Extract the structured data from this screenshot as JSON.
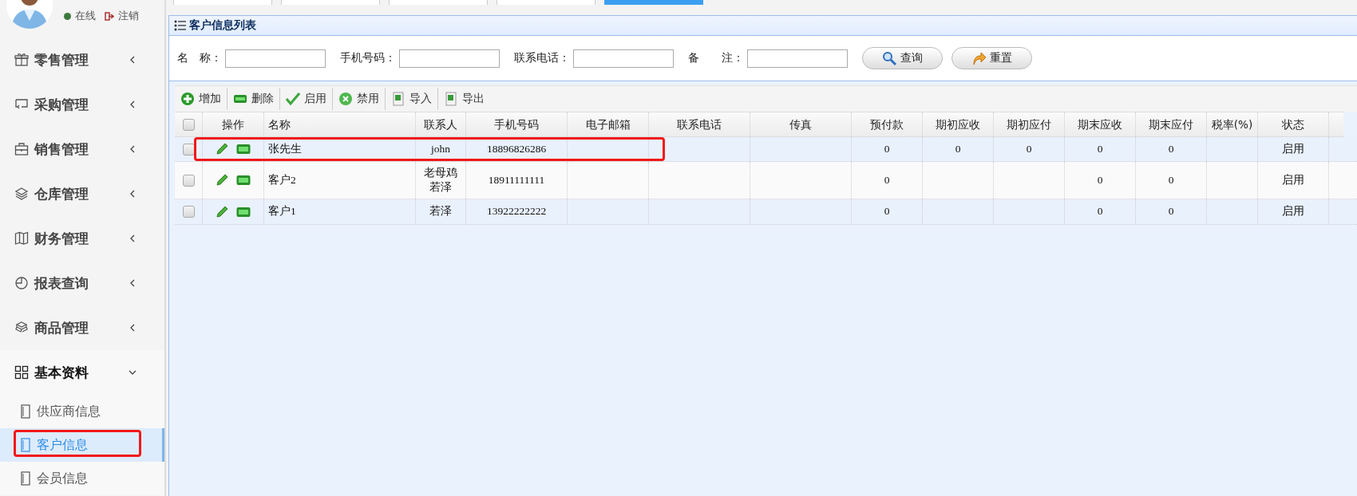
{
  "user": {
    "status": "在线",
    "logout": "注销"
  },
  "tabs": [
    {
      "selected": false
    },
    {
      "selected": false
    },
    {
      "selected": false
    },
    {
      "selected": false
    },
    {
      "selected": true
    }
  ],
  "sidebar": {
    "items": [
      {
        "label": "零售管理",
        "expanded": false
      },
      {
        "label": "采购管理",
        "expanded": false
      },
      {
        "label": "销售管理",
        "expanded": false
      },
      {
        "label": "仓库管理",
        "expanded": false
      },
      {
        "label": "财务管理",
        "expanded": false
      },
      {
        "label": "报表查询",
        "expanded": false
      },
      {
        "label": "商品管理",
        "expanded": false
      },
      {
        "label": "基本资料",
        "expanded": true,
        "children": [
          {
            "label": "供应商信息",
            "selected": false,
            "highlighted": false
          },
          {
            "label": "客户信息",
            "selected": true,
            "highlighted": true
          },
          {
            "label": "会员信息",
            "selected": false,
            "highlighted": false
          }
        ]
      }
    ]
  },
  "panel": {
    "title": "客户信息列表"
  },
  "search": {
    "fields": [
      {
        "label": "名　称："
      },
      {
        "label": "手机号码："
      },
      {
        "label": "联系电话："
      },
      {
        "label": "备　　注："
      }
    ],
    "buttons": [
      "查询",
      "重置"
    ]
  },
  "toolbar": [
    "增加",
    "删除",
    "启用",
    "禁用",
    "导入",
    "导出"
  ],
  "table": {
    "header_checked": false,
    "columns": [
      "操作",
      "名称",
      "联系人",
      "手机号码",
      "电子邮箱",
      "联系电话",
      "传真",
      "预付款",
      "期初应收",
      "期初应付",
      "期末应收",
      "期末应付",
      "税率(%)",
      "状态"
    ],
    "rows": [
      {
        "checked": false,
        "highlighted": true,
        "cells": [
          null,
          "张先生",
          "john",
          "18896826286",
          null,
          null,
          null,
          "0",
          "0",
          "0",
          "0",
          "0",
          null,
          "启用"
        ]
      },
      {
        "checked": false,
        "highlighted": false,
        "cells": [
          null,
          "客户2",
          "老母鸡若泽",
          "18911111111",
          null,
          null,
          null,
          "0",
          null,
          null,
          "0",
          "0",
          null,
          "启用"
        ]
      },
      {
        "checked": false,
        "highlighted": false,
        "cells": [
          null,
          "客户1",
          "若泽",
          "13922222222",
          null,
          null,
          null,
          "0",
          null,
          null,
          "0",
          "0",
          null,
          "启用"
        ]
      }
    ]
  }
}
